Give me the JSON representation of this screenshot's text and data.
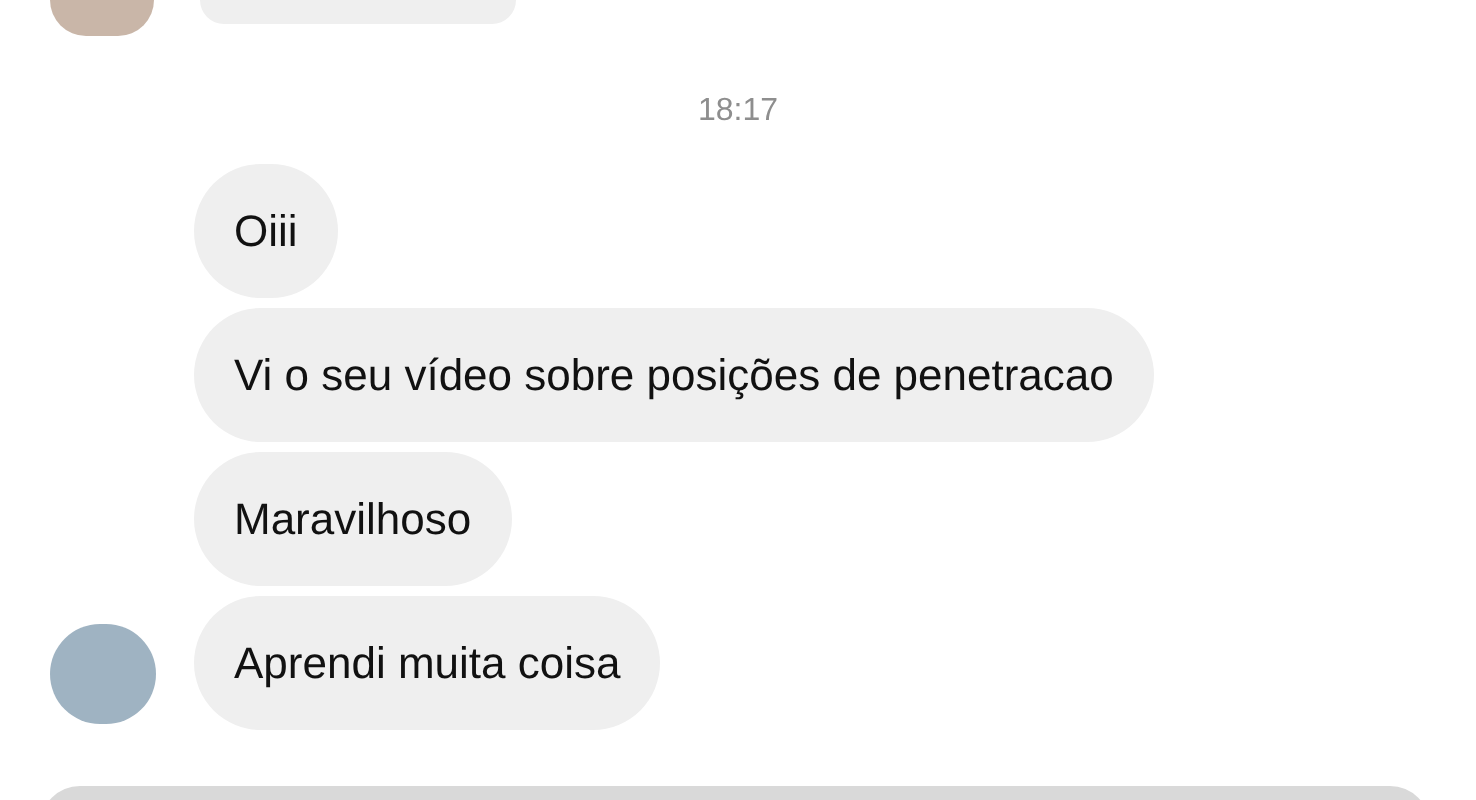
{
  "timestamp": "18:17",
  "messages": [
    {
      "text": "Oiii"
    },
    {
      "text": "Vi o seu vídeo sobre posições de penetracao"
    },
    {
      "text": "Maravilhoso"
    },
    {
      "text": "Aprendi muita coisa"
    }
  ]
}
